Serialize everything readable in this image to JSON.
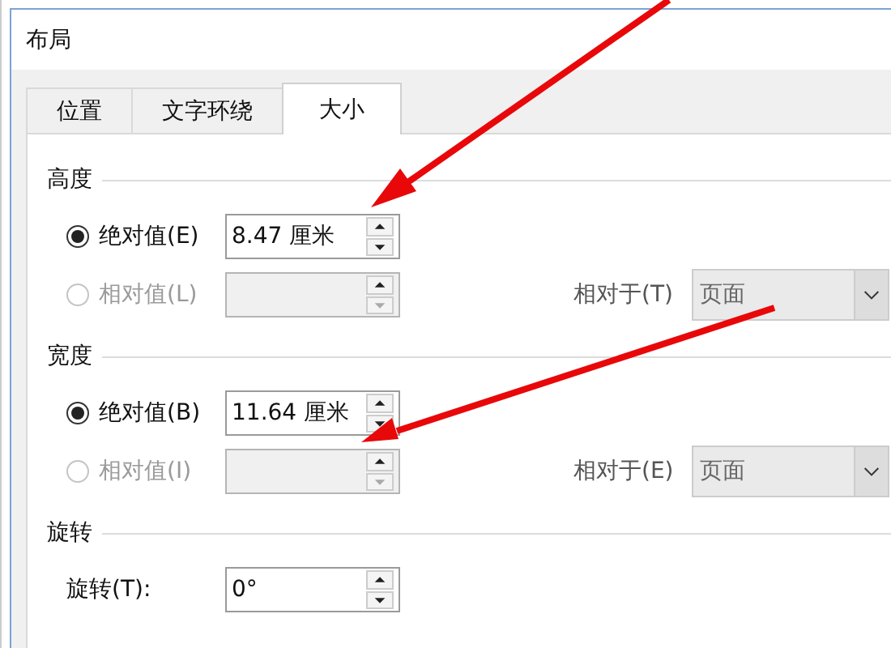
{
  "window": {
    "title": "布局"
  },
  "tabs": [
    {
      "label": "位置",
      "selected": false
    },
    {
      "label": "文字环绕",
      "selected": false
    },
    {
      "label": "大小",
      "selected": true
    }
  ],
  "sections": [
    {
      "title": "高度",
      "rows": [
        {
          "kind": "radio",
          "label": "绝对值(E)",
          "selected": true,
          "disabled": false,
          "value": "8.47 厘米"
        },
        {
          "kind": "radio",
          "label": "相对值(L)",
          "selected": false,
          "disabled": true,
          "relative_label": "相对于(T)",
          "relative_value": "页面"
        }
      ]
    },
    {
      "title": "宽度",
      "rows": [
        {
          "kind": "radio",
          "label": "绝对值(B)",
          "selected": true,
          "disabled": false,
          "value": "11.64 厘米"
        },
        {
          "kind": "radio",
          "label": "相对值(I)",
          "selected": false,
          "disabled": true,
          "relative_label": "相对于(E)",
          "relative_value": "页面"
        }
      ]
    },
    {
      "title": "旋转",
      "rows": [
        {
          "kind": "plain",
          "label": "旋转(T):",
          "value": "0°"
        }
      ]
    }
  ]
}
